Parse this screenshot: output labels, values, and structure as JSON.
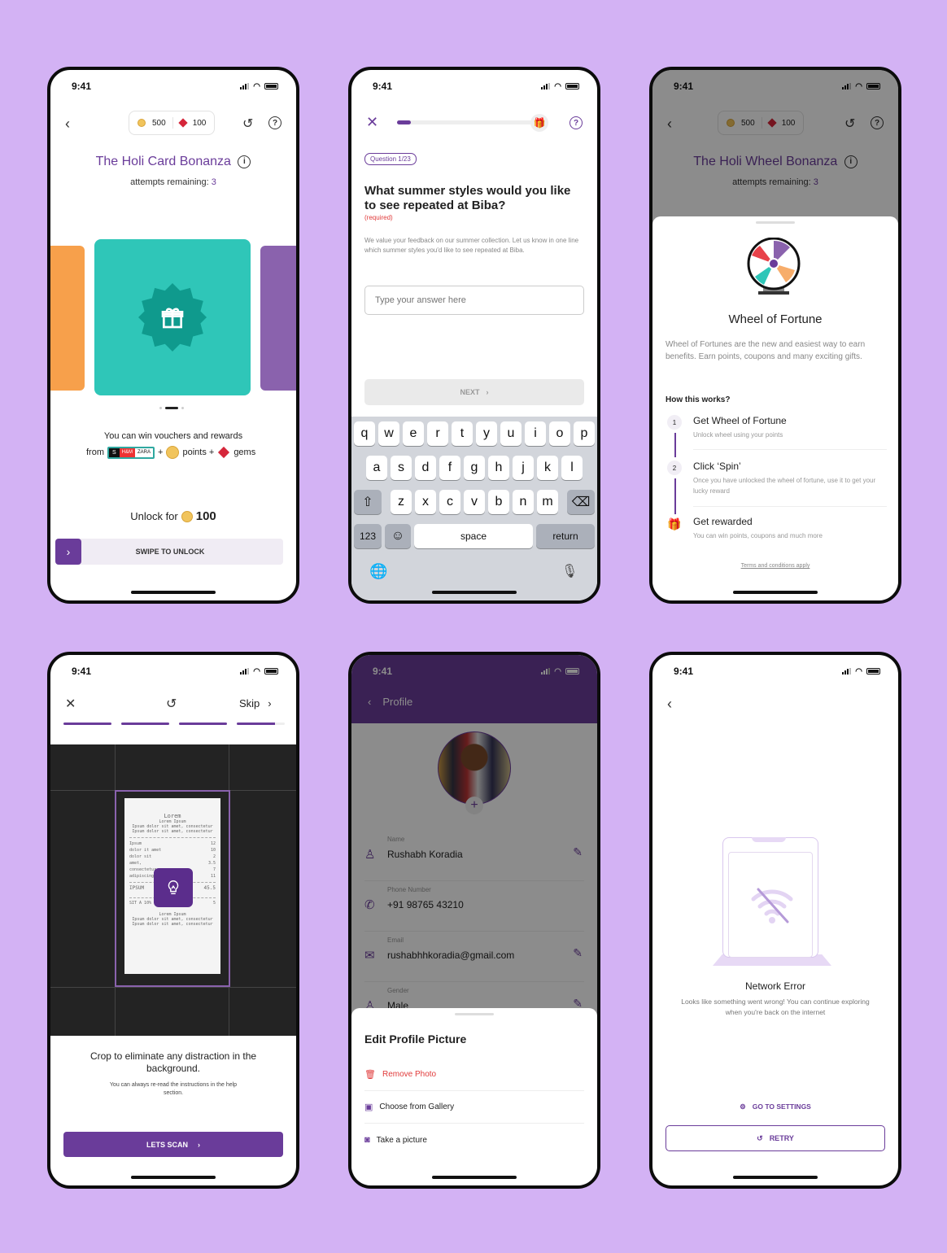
{
  "status_time": "9:41",
  "card_game": {
    "points": "500",
    "gems": "100",
    "title": "The Holi Card Bonanza",
    "attempts_label": "attempts remaining:",
    "attempts_value": "3",
    "card_colors": {
      "left": "#f7a04b",
      "center": "#2fc6b8",
      "right": "#8a62ad",
      "badge": "#0f9a8d"
    },
    "reward_line1": "You can win vouchers and rewards",
    "reward_from": "from",
    "reward_points": "points +",
    "reward_gems": "gems",
    "brands": [
      "S",
      "H&M",
      "ZARA"
    ],
    "unlock_label": "Unlock for",
    "unlock_value": "100",
    "swipe_label": "SWIPE TO UNLOCK"
  },
  "survey": {
    "question_badge": "Question 1/23",
    "progress": 0.1,
    "question": "What summer styles would you like to see repeated at Biba?",
    "required": "(required)",
    "description": "We value your feedback on our summer collection. Let us know in one line which summer styles you'd like to see repeated at Biba.",
    "answer_placeholder": "Type your answer here",
    "next_label": "NEXT",
    "keyboard": {
      "row1": [
        "q",
        "w",
        "e",
        "r",
        "t",
        "y",
        "u",
        "i",
        "o",
        "p"
      ],
      "row2": [
        "a",
        "s",
        "d",
        "f",
        "g",
        "h",
        "j",
        "k",
        "l"
      ],
      "row3": [
        "z",
        "x",
        "c",
        "v",
        "b",
        "n",
        "m"
      ],
      "numbers": "123",
      "space": "space",
      "return": "return"
    }
  },
  "wheel": {
    "points": "500",
    "gems": "100",
    "title": "The Holi Wheel Bonanza",
    "attempts_label": "attempts remaining:",
    "attempts_value": "3",
    "sheet_title": "Wheel of Fortune",
    "sheet_desc": "Wheel of Fortunes are the new and easiest way to earn benefits. Earn points, coupons and many exciting gifts.",
    "how_title": "How this works?",
    "steps": [
      {
        "num": "1",
        "title": "Get Wheel of Fortune",
        "desc": "Unlock wheel using your points"
      },
      {
        "num": "2",
        "title": "Click ‘Spin’",
        "desc": "Once you have unlocked the wheel of fortune, use it to get your lucky reward"
      },
      {
        "num": "",
        "title": "Get rewarded",
        "desc": "You can win points, coupons and much more"
      }
    ],
    "terms": "Terms and conditions apply"
  },
  "scan": {
    "skip_label": "Skip",
    "steps_total": 4,
    "receipt": {
      "title": "Lorem",
      "sub": "Lorem Ipsum",
      "lines": [
        "Ipsum dolor sit amet, consectetur",
        "Ipsum dolor sit amet, consectetur"
      ],
      "items": [
        [
          "Ipsum",
          "12"
        ],
        [
          "dolor it amet",
          "10"
        ],
        [
          "dolor sit",
          "2"
        ],
        [
          "amet,",
          "3.5"
        ],
        [
          "consectetur",
          "7"
        ],
        [
          "adipiscing",
          "11"
        ]
      ],
      "total_label": "IPSUM",
      "total_value": "45.5",
      "tax_label": "SIT A 10%",
      "tax_value": "5",
      "footer_sub": "Lorem Ipsum",
      "footer_lines": [
        "Ipsum dolor sit amet, consectetur",
        "Ipsum dolor sit amet, consectetur"
      ]
    },
    "heading": "Crop to eliminate any distraction in the background.",
    "sub": "You can always re-read the instructions in the help section.",
    "button": "LETS SCAN"
  },
  "profile": {
    "header_title": "Profile",
    "fields": [
      {
        "label": "Name",
        "value": "Rushabh Koradia",
        "icon": "user-icon",
        "editable": true
      },
      {
        "label": "Phone Number",
        "value": "+91 98765 43210",
        "icon": "phone-icon",
        "editable": false
      },
      {
        "label": "Email",
        "value": "rushabhhkoradia@gmail.com",
        "icon": "mail-icon",
        "editable": true
      },
      {
        "label": "Gender",
        "value": "Male",
        "icon": "user-icon",
        "editable": true
      }
    ],
    "sheet_title": "Edit Profile Picture",
    "actions": [
      {
        "label": "Remove Photo",
        "icon": "trash-icon",
        "danger": true
      },
      {
        "label": "Choose from Gallery",
        "icon": "image-icon",
        "danger": false
      },
      {
        "label": "Take a picture",
        "icon": "camera-icon",
        "danger": false
      }
    ]
  },
  "network": {
    "title": "Network Error",
    "desc": "Looks like something went wrong! You can continue exploring when you're back on the internet",
    "settings_label": "GO TO SETTINGS",
    "retry_label": "RETRY"
  }
}
